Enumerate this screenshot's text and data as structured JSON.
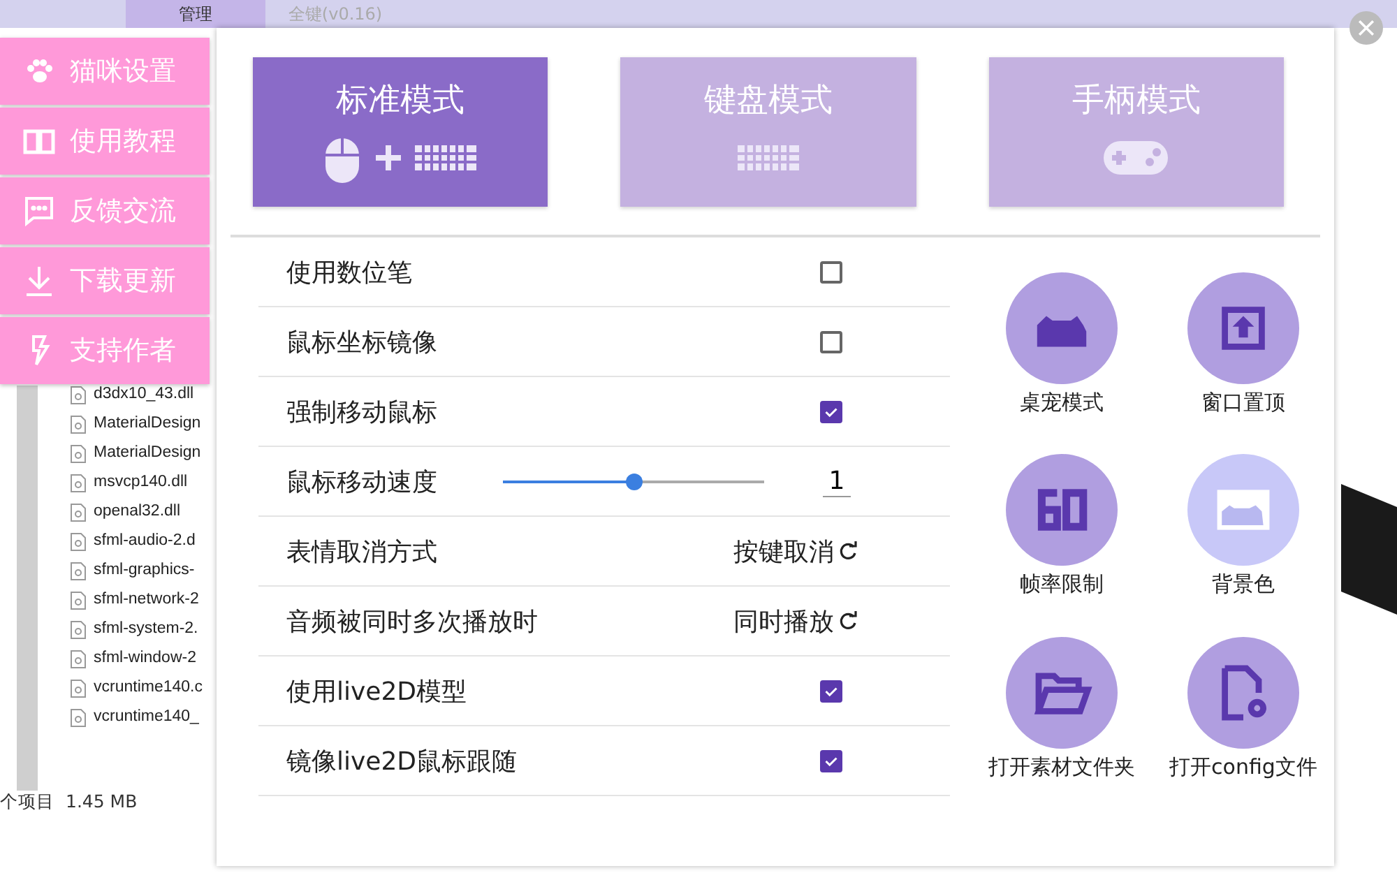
{
  "explorer": {
    "tabs": [
      {
        "label": "管理",
        "selected": true
      },
      {
        "label": "全键(v0.16)",
        "selected": false
      }
    ],
    "files": [
      "d3dx10_43.dll",
      "MaterialDesign",
      "MaterialDesign",
      "msvcp140.dll",
      "openal32.dll",
      "sfml-audio-2.d",
      "sfml-graphics-",
      "sfml-network-2",
      "sfml-system-2.",
      "sfml-window-2",
      "vcruntime140.c",
      "vcruntime140_"
    ],
    "status": {
      "count": "个项目",
      "size": "1.45 MB"
    }
  },
  "menu": [
    {
      "label": "猫咪设置"
    },
    {
      "label": "使用教程"
    },
    {
      "label": "反馈交流"
    },
    {
      "label": "下载更新"
    },
    {
      "label": "支持作者"
    }
  ],
  "modes": [
    {
      "label": "标准模式",
      "selected": true
    },
    {
      "label": "键盘模式",
      "selected": false
    },
    {
      "label": "手柄模式",
      "selected": false
    }
  ],
  "settings": [
    {
      "kind": "checkbox",
      "label": "使用数位笔",
      "checked": false
    },
    {
      "kind": "checkbox",
      "label": "鼠标坐标镜像",
      "checked": false
    },
    {
      "kind": "checkbox",
      "label": "强制移动鼠标",
      "checked": true
    },
    {
      "kind": "slider",
      "label": "鼠标移动速度",
      "level": 0.5,
      "value": "1"
    },
    {
      "kind": "cycle",
      "label": "表情取消方式",
      "value": "按键取消"
    },
    {
      "kind": "cycle",
      "label": "音频被同时多次播放时",
      "value": "同时播放"
    },
    {
      "kind": "checkbox",
      "label": "使用live2D模型",
      "checked": true
    },
    {
      "kind": "checkbox",
      "label": "镜像live2D鼠标跟随",
      "checked": true
    }
  ],
  "tools": [
    {
      "label": "桌宠模式",
      "color": "#b09ee0"
    },
    {
      "label": "窗口置顶",
      "color": "#b09ee0"
    },
    {
      "label": "帧率限制",
      "color": "#b09ee0"
    },
    {
      "label": "背景色",
      "color": "#c8c8f8"
    },
    {
      "label": "打开素材文件夹",
      "color": "#b09ee0"
    },
    {
      "label": "打开config文件",
      "color": "#b09ee0"
    }
  ]
}
